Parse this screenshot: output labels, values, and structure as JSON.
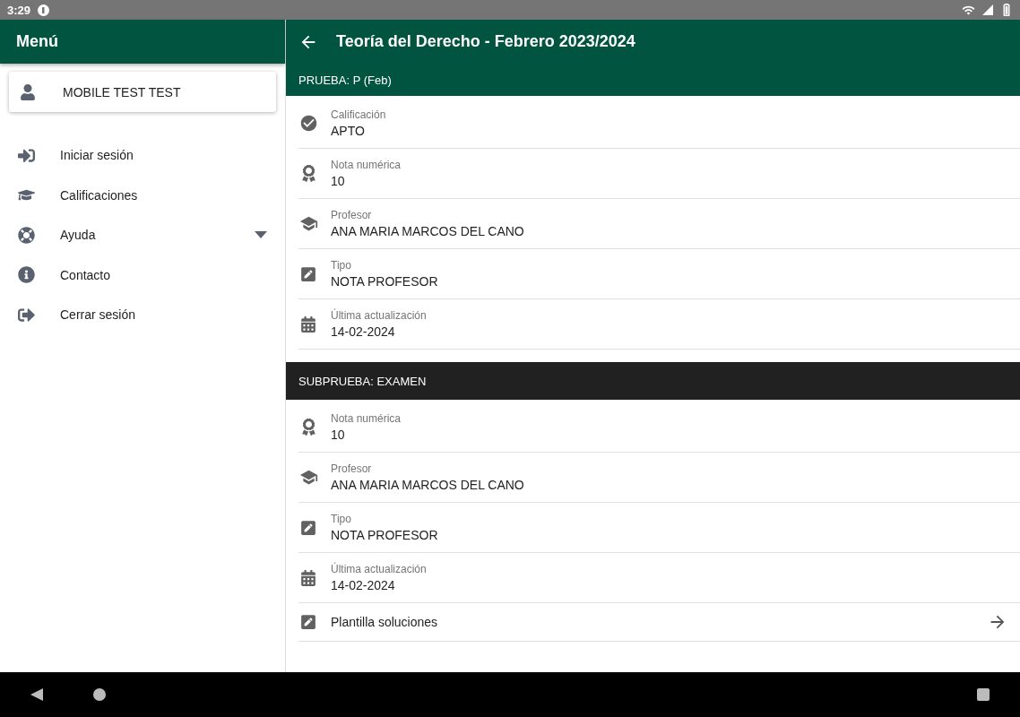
{
  "status_bar": {
    "time": "3:29"
  },
  "drawer": {
    "title": "Menú",
    "user": "MOBILE TEST TEST",
    "items": [
      {
        "label": "Iniciar sesión",
        "kind": "login"
      },
      {
        "label": "Calificaciones",
        "kind": "grades"
      },
      {
        "label": "Ayuda",
        "kind": "help",
        "expanded": false
      },
      {
        "label": "Contacto",
        "kind": "info"
      },
      {
        "label": "Cerrar sesión",
        "kind": "logout"
      }
    ]
  },
  "main": {
    "title": "Teoría del Derecho - Febrero 2023/2024",
    "sections": [
      {
        "title": "PRUEBA: P (Feb)",
        "kind": "main",
        "rows": [
          {
            "kind": "grade",
            "label": "Calificación",
            "value": "APTO"
          },
          {
            "kind": "score",
            "label": "Nota numérica",
            "value": "10"
          },
          {
            "kind": "teacher",
            "label": "Profesor",
            "value": "ANA MARIA MARCOS DEL CANO"
          },
          {
            "kind": "type",
            "label": "Tipo",
            "value": "NOTA PROFESOR"
          },
          {
            "kind": "date",
            "label": "Última actualización",
            "value": "14-02-2024"
          }
        ]
      },
      {
        "title": "SUBPRUEBA: EXAMEN",
        "kind": "sub",
        "rows": [
          {
            "kind": "score",
            "label": "Nota numérica",
            "value": "10"
          },
          {
            "kind": "teacher",
            "label": "Profesor",
            "value": "ANA MARIA MARCOS DEL CANO"
          },
          {
            "kind": "type",
            "label": "Tipo",
            "value": "NOTA PROFESOR"
          },
          {
            "kind": "date",
            "label": "Última actualización",
            "value": "14-02-2024"
          },
          {
            "kind": "link",
            "value": "Plantilla soluciones"
          }
        ]
      }
    ]
  }
}
